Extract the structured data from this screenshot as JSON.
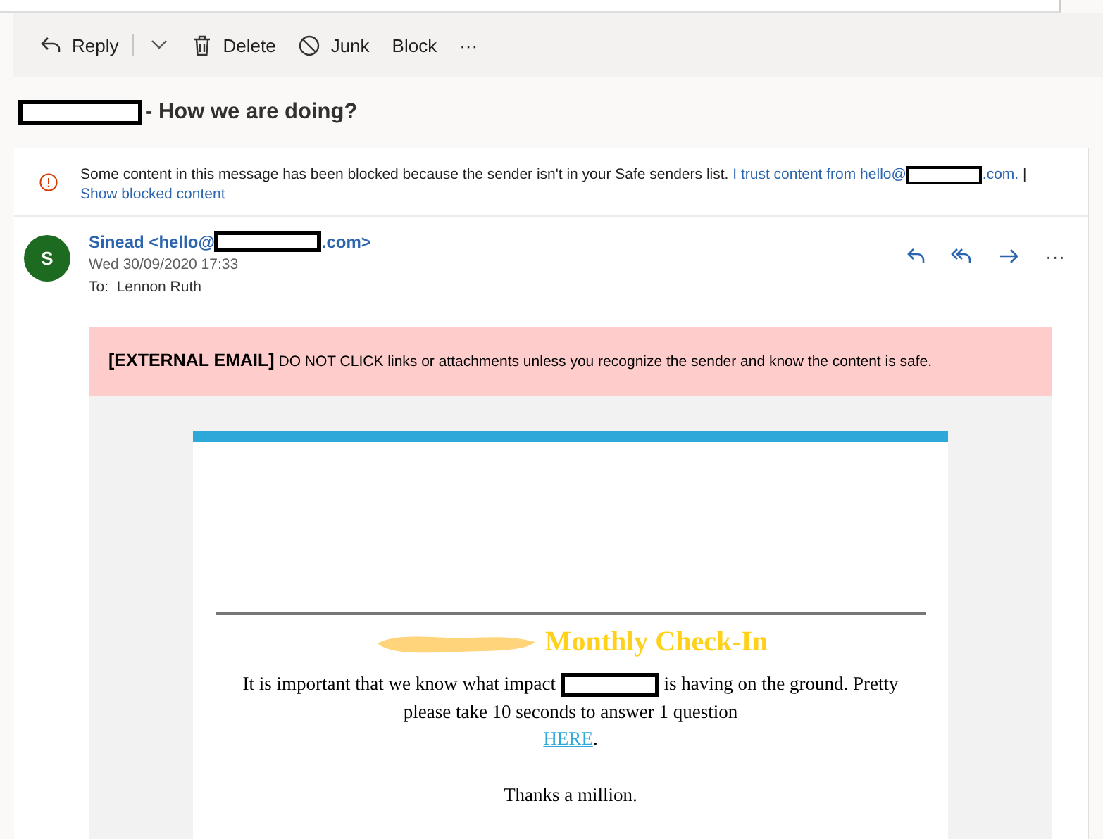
{
  "toolbar": [
    {
      "kind": "reply",
      "label": "Reply"
    },
    {
      "kind": "dropdown"
    },
    {
      "kind": "delete",
      "label": "Delete"
    },
    {
      "kind": "junk",
      "label": "Junk"
    },
    {
      "kind": "plain",
      "label": "Block"
    },
    {
      "kind": "plain",
      "label": "···"
    }
  ],
  "subject": {
    "text": "- How we are doing?"
  },
  "notice": {
    "text": "Some content in this message has been blocked because the sender isn't in your Safe senders list.",
    "trust_start": "I trust content from hello@",
    "trust_end": ".com.",
    "separator": "|",
    "show_link": "Show blocked content"
  },
  "sender": {
    "initial": "S",
    "name_start": "Sinead <hello@",
    "name_end": ".com>",
    "date": "Wed 30/09/2020 17:33",
    "to_label": "To:",
    "to": "Lennon Ruth"
  },
  "actions": [
    {
      "kind": "reply"
    },
    {
      "kind": "reply-all"
    },
    {
      "kind": "forward"
    },
    {
      "kind": "more",
      "label": "···"
    }
  ],
  "banner": {
    "text": "**[EXTERNAL EMAIL]** DO NOT CLICK links or attachments unless you recognize the sender and know the content is safe."
  },
  "email": {
    "title": "Monthly Check-In",
    "para_start": "It is important that we know what impact",
    "para_end": "is having on the ground. Pretty please take 10 seconds to answer 1 question",
    "link": "HERE",
    "link_after": ".",
    "closing": "Thanks a million."
  }
}
